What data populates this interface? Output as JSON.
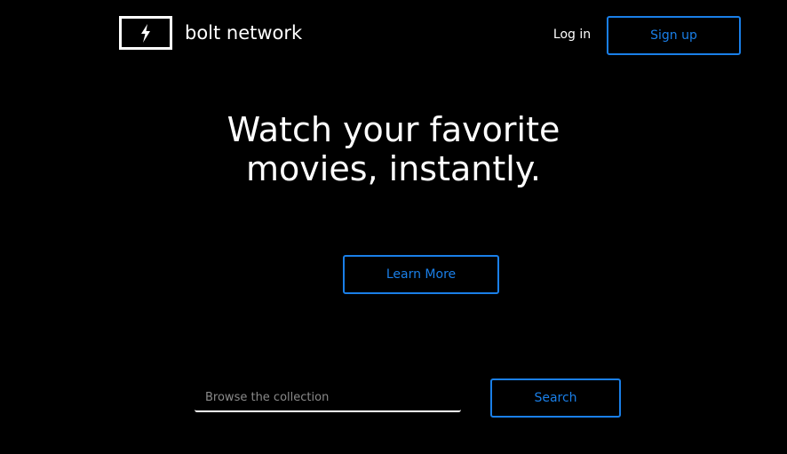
{
  "header": {
    "brand_name": "bolt network",
    "login_label": "Log in",
    "signup_label": "Sign up"
  },
  "hero": {
    "heading_line1": "Watch your favorite",
    "heading_line2": "movies, instantly.",
    "learn_more_label": "Learn More"
  },
  "search": {
    "placeholder": "Browse the collection",
    "value": "",
    "button_label": "Search"
  },
  "icons": {
    "logo": "bolt-icon"
  },
  "colors": {
    "background": "#000000",
    "text": "#ffffff",
    "accent": "#1a7fe8",
    "placeholder": "#8a8a8a"
  }
}
